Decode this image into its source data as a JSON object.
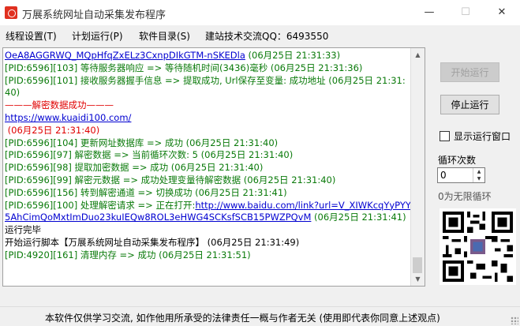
{
  "window": {
    "title": "万展系统网址自动采集发布程序",
    "minimize_icon": "—",
    "maximize_icon": "☐",
    "close_icon": "✕"
  },
  "menu": [
    {
      "label": "线程设置(T)"
    },
    {
      "label": "计划运行(P)"
    },
    {
      "label": "软件目录(S)"
    },
    {
      "label": "建站技术交流QQ：6493550"
    }
  ],
  "log": {
    "lines": [
      {
        "text": "OeA8AGGRWQ_MQpHfqZxELz3CxnpDIkGTM-nSKEDla (06月25日 21:31:33)",
        "color": "blue-mixed"
      },
      {
        "text": "[PID:6596][103] 等待服务器响应 => 等待随机时间(3436)毫秒 (06月25日 21:31:36)",
        "color": "green"
      },
      {
        "text": "[PID:6596][101] 接收服务器握手信息 => 提取成功, Url保存至变量: 成功地址 (06月25日 21:31:40)",
        "color": "green"
      },
      {
        "text": "———解密数据成功———",
        "color": "red"
      },
      {
        "text": "https://www.kuaidi100.com/",
        "color": "blue"
      },
      {
        "text": " (06月25日 21:31:40)",
        "color": "red"
      },
      {
        "text": "[PID:6596][104] 更新网址数据库 => 成功 (06月25日 21:31:40)",
        "color": "green"
      },
      {
        "text": "[PID:6596][97] 解密数据 => 当前循环次数: 5 (06月25日 21:31:40)",
        "color": "green"
      },
      {
        "text": "[PID:6596][98] 提取加密数据 => 成功 (06月25日 21:31:40)",
        "color": "green"
      },
      {
        "text": "[PID:6596][99] 解密元数据 => 成功处理变量待解密数据 (06月25日 21:31:40)",
        "color": "green"
      },
      {
        "text": "[PID:6596][156] 转到解密通道 => 切换成功 (06月25日 21:31:41)",
        "color": "green"
      },
      {
        "text": "[PID:6596][100] 处理解密请求 => 正在打开:",
        "link": "http://www.baidu.com/link?url=V_XIWKcqYyPYY5AhCimQoMxtImDuo23kuIEQw8ROL3eHWG4SCKsfSCB15PWZPQvM",
        "suffix": " (06月25日 21:31:41)",
        "color": "green-link"
      },
      {
        "text": "运行完毕",
        "color": "black"
      },
      {
        "text": "开始运行脚本【万展系统网址自动采集发布程序】 (06月25日 21:31:49)",
        "color": "black"
      },
      {
        "text": "[PID:4920][161] 清理内存 => 成功 (06月25日 21:31:51)",
        "color": "green"
      }
    ]
  },
  "controls": {
    "start_label": "开始运行",
    "stop_label": "停止运行",
    "show_window_label": "显示运行窗口",
    "loop_label": "循环次数",
    "loop_value": "0",
    "loop_hint": "0为无限循环"
  },
  "status_bar": {
    "text": "本软件仅供学习交流, 如作他用所承受的法律责任一概与作者无关 (使用即代表你同意上述观点)"
  },
  "colors": {
    "green": "#0a7a0a",
    "red": "#e00000",
    "link": "#0000d0",
    "app_icon": "#e03020"
  }
}
